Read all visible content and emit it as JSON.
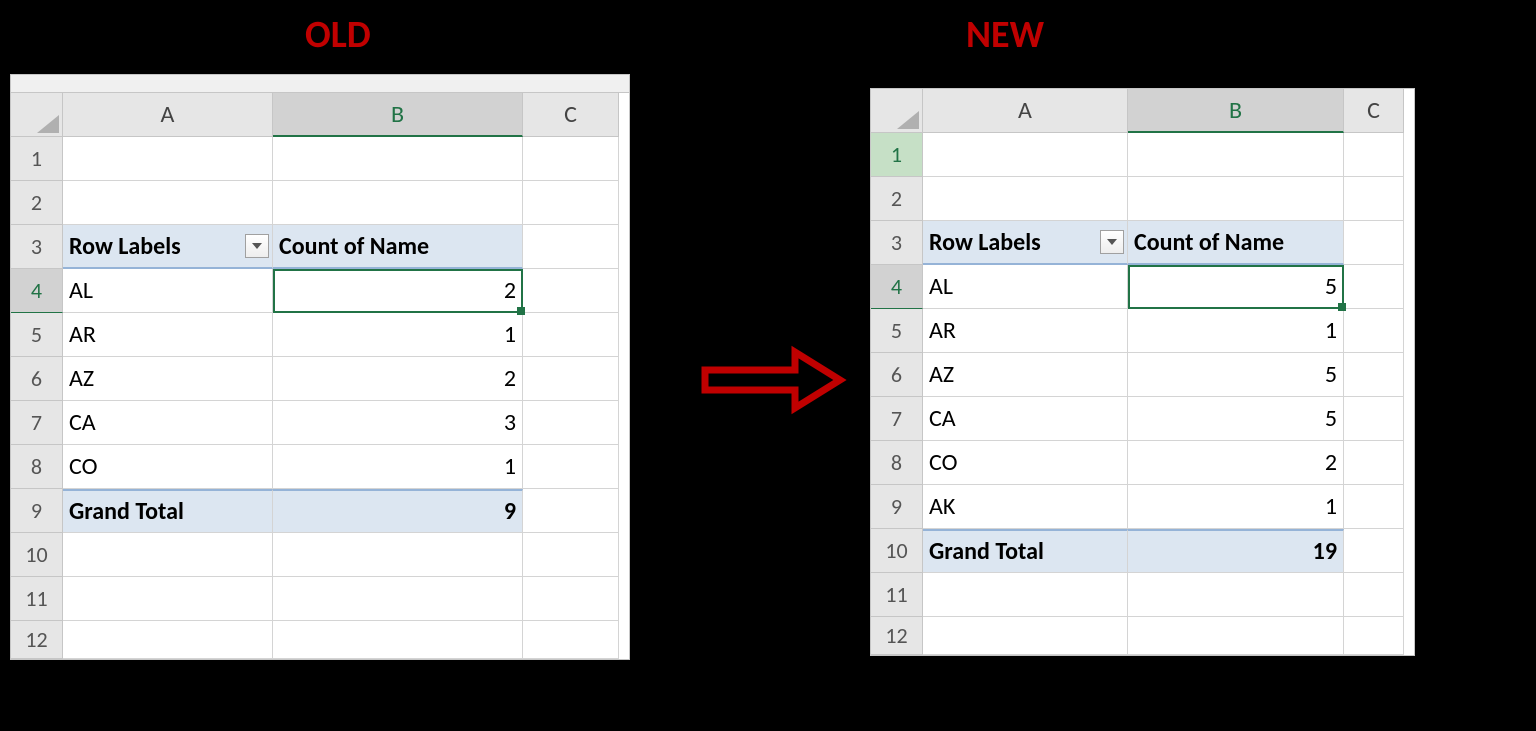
{
  "titles": {
    "old": "OLD",
    "new": "NEW"
  },
  "cols": [
    "A",
    "B",
    "C"
  ],
  "old": {
    "rows": [
      "1",
      "2",
      "3",
      "4",
      "5",
      "6",
      "7",
      "8",
      "9",
      "10",
      "11",
      "12"
    ],
    "header": {
      "rowLabels": "Row Labels",
      "count": "Count of Name"
    },
    "data": [
      {
        "label": "AL",
        "value": "2"
      },
      {
        "label": "AR",
        "value": "1"
      },
      {
        "label": "AZ",
        "value": "2"
      },
      {
        "label": "CA",
        "value": "3"
      },
      {
        "label": "CO",
        "value": "1"
      }
    ],
    "total": {
      "label": "Grand Total",
      "value": "9"
    },
    "selectedRow": "4",
    "colWidths": {
      "A": 210,
      "B": 250,
      "C": 96
    }
  },
  "new": {
    "rows": [
      "1",
      "2",
      "3",
      "4",
      "5",
      "6",
      "7",
      "8",
      "9",
      "10",
      "11",
      "12"
    ],
    "header": {
      "rowLabels": "Row Labels",
      "count": "Count of Name"
    },
    "data": [
      {
        "label": "AL",
        "value": "5"
      },
      {
        "label": "AR",
        "value": "1"
      },
      {
        "label": "AZ",
        "value": "5"
      },
      {
        "label": "CA",
        "value": "5"
      },
      {
        "label": "CO",
        "value": "2"
      },
      {
        "label": "AK",
        "value": "1"
      }
    ],
    "total": {
      "label": "Grand Total",
      "value": "19"
    },
    "selectedRow": "4",
    "colWidths": {
      "A": 205,
      "B": 216,
      "C": 60
    }
  }
}
